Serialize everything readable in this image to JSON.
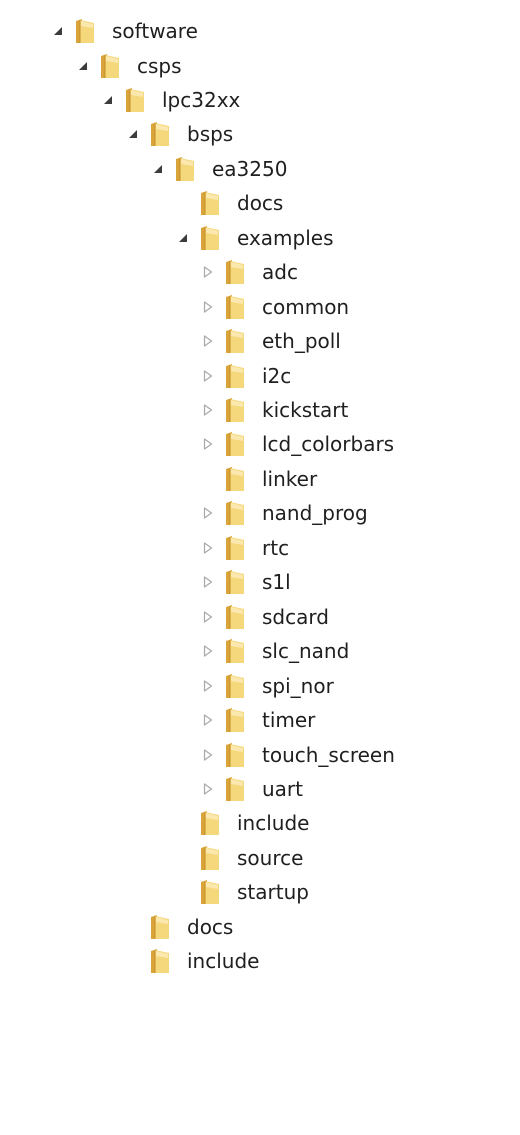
{
  "tree": {
    "nodes": [
      {
        "label": "software",
        "depth": 0,
        "toggle": "expanded"
      },
      {
        "label": "csps",
        "depth": 1,
        "toggle": "expanded"
      },
      {
        "label": "lpc32xx",
        "depth": 2,
        "toggle": "expanded"
      },
      {
        "label": "bsps",
        "depth": 3,
        "toggle": "expanded"
      },
      {
        "label": "ea3250",
        "depth": 4,
        "toggle": "expanded"
      },
      {
        "label": "docs",
        "depth": 5,
        "toggle": "none"
      },
      {
        "label": "examples",
        "depth": 5,
        "toggle": "expanded"
      },
      {
        "label": "adc",
        "depth": 6,
        "toggle": "collapsed"
      },
      {
        "label": "common",
        "depth": 6,
        "toggle": "collapsed"
      },
      {
        "label": "eth_poll",
        "depth": 6,
        "toggle": "collapsed"
      },
      {
        "label": "i2c",
        "depth": 6,
        "toggle": "collapsed"
      },
      {
        "label": "kickstart",
        "depth": 6,
        "toggle": "collapsed"
      },
      {
        "label": "lcd_colorbars",
        "depth": 6,
        "toggle": "collapsed"
      },
      {
        "label": "linker",
        "depth": 6,
        "toggle": "none"
      },
      {
        "label": "nand_prog",
        "depth": 6,
        "toggle": "collapsed"
      },
      {
        "label": "rtc",
        "depth": 6,
        "toggle": "collapsed"
      },
      {
        "label": "s1l",
        "depth": 6,
        "toggle": "collapsed"
      },
      {
        "label": "sdcard",
        "depth": 6,
        "toggle": "collapsed"
      },
      {
        "label": "slc_nand",
        "depth": 6,
        "toggle": "collapsed"
      },
      {
        "label": "spi_nor",
        "depth": 6,
        "toggle": "collapsed"
      },
      {
        "label": "timer",
        "depth": 6,
        "toggle": "collapsed"
      },
      {
        "label": "touch_screen",
        "depth": 6,
        "toggle": "collapsed"
      },
      {
        "label": "uart",
        "depth": 6,
        "toggle": "collapsed"
      },
      {
        "label": "include",
        "depth": 5,
        "toggle": "none"
      },
      {
        "label": "source",
        "depth": 5,
        "toggle": "none"
      },
      {
        "label": "startup",
        "depth": 5,
        "toggle": "none"
      },
      {
        "label": "docs",
        "depth": 3,
        "toggle": "none"
      },
      {
        "label": "include",
        "depth": 3,
        "toggle": "none"
      }
    ]
  },
  "icons": {
    "expanded_toggle": "expanded-arrow-icon",
    "collapsed_toggle": "collapsed-arrow-icon",
    "folder": "folder-icon"
  },
  "colors": {
    "expanded_arrow": "#3c3c3c",
    "collapsed_arrow": "#a8a8a8",
    "folder_back": "#d9a53a",
    "folder_front": "#f5d77c",
    "folder_highlight": "#fbeab4",
    "text": "#1f1f1f"
  }
}
